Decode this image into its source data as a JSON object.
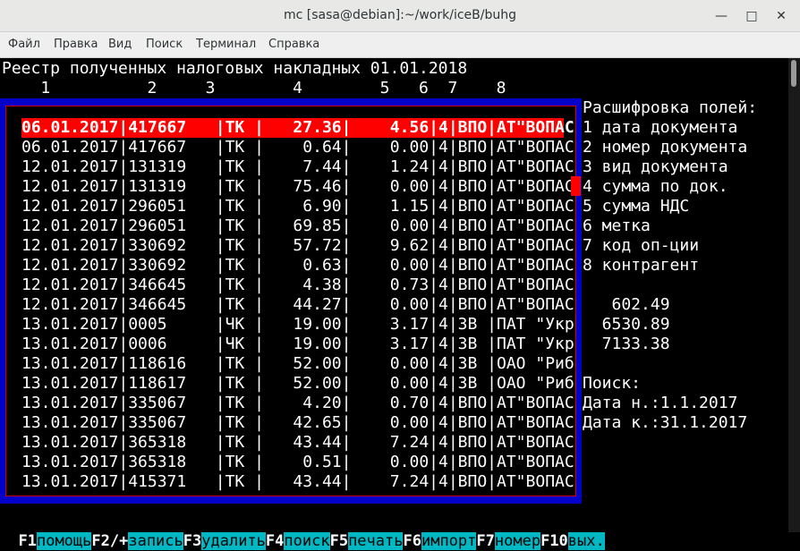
{
  "window": {
    "title": "mc [sasa@debian]:~/work/iceB/buhg"
  },
  "menu": [
    "Файл",
    "Правка",
    "Вид",
    "Поиск",
    "Терминал",
    "Справка"
  ],
  "report": {
    "title": "Реестр полученных налоговых накладных 01.01.2018",
    "column_numbers": "    1          2     3        4        5   6  7    8"
  },
  "rows": [
    "06.01.2017|417667   |ТК |   27.36|    4.56|4|ВПО|АТ\"ВОПАС",
    "06.01.2017|417667   |ТК |    0.64|    0.00|4|ВПО|АТ\"ВОПАС",
    "12.01.2017|131319   |ТК |    7.44|    1.24|4|ВПО|АТ\"ВОПАС",
    "12.01.2017|131319   |ТК |   75.46|    0.00|4|ВПО|АТ\"ВОПАС",
    "12.01.2017|296051   |ТК |    6.90|    1.15|4|ВПО|АТ\"ВОПАС",
    "12.01.2017|296051   |ТК |   69.85|    0.00|4|ВПО|АТ\"ВОПАС",
    "12.01.2017|330692   |ТК |   57.72|    9.62|4|ВПО|АТ\"ВОПАС",
    "12.01.2017|330692   |ТК |    0.63|    0.00|4|ВПО|АТ\"ВОПАС",
    "12.01.2017|346645   |ТК |    4.38|    0.73|4|ВПО|АТ\"ВОПАС",
    "12.01.2017|346645   |ТК |   44.27|    0.00|4|ВПО|АТ\"ВОПАС",
    "13.01.2017|0005     |ЧК |   19.00|    3.17|4|ЗВ |ПАТ \"Укр",
    "13.01.2017|0006     |ЧК |   19.00|    3.17|4|ЗВ |ПАТ \"Укр",
    "13.01.2017|118616   |ТК |   52.00|    0.00|4|ЗВ |ОАО \"Риб",
    "13.01.2017|118617   |ТК |   52.00|    0.00|4|ЗВ |ОАО \"Риб",
    "13.01.2017|335067   |ТК |    4.20|    0.70|4|ВПО|АТ\"ВОПАС",
    "13.01.2017|335067   |ТК |   42.65|    0.00|4|ВПО|АТ\"ВОПАС",
    "13.01.2017|365318   |ТК |   43.44|    7.24|4|ВПО|АТ\"ВОПАС",
    "13.01.2017|365318   |ТК |    0.51|    0.00|4|ВПО|АТ\"ВОПАС",
    "13.01.2017|415371   |ТК |   43.44|    7.24|4|ВПО|АТ\"ВОПАС"
  ],
  "legend": {
    "title": "Расшифровка полей:",
    "items": [
      "1 дата документа",
      "2 номер документа",
      "3 вид документа",
      "4 сумма по док.",
      "5 сумма НДС",
      "6 метка",
      "7 код оп-ции",
      "8 контрагент"
    ]
  },
  "totals": [
    "   602.49",
    "  6530.89",
    "  7133.38"
  ],
  "search": {
    "title": "Поиск:",
    "from": "Дата н.:1.1.2017",
    "to": "Дата к.:31.1.2017"
  },
  "fkeys": [
    {
      "key": "F1",
      "label": "помощь"
    },
    {
      "key": "F2/+",
      "label": "запись"
    },
    {
      "key": "F3",
      "label": "удалить"
    },
    {
      "key": "F4",
      "label": "поиск"
    },
    {
      "key": "F5",
      "label": "печать"
    },
    {
      "key": "F6",
      "label": "импорт"
    },
    {
      "key": "F7",
      "label": "номер"
    },
    {
      "key": "F10",
      "label": "вых."
    }
  ]
}
